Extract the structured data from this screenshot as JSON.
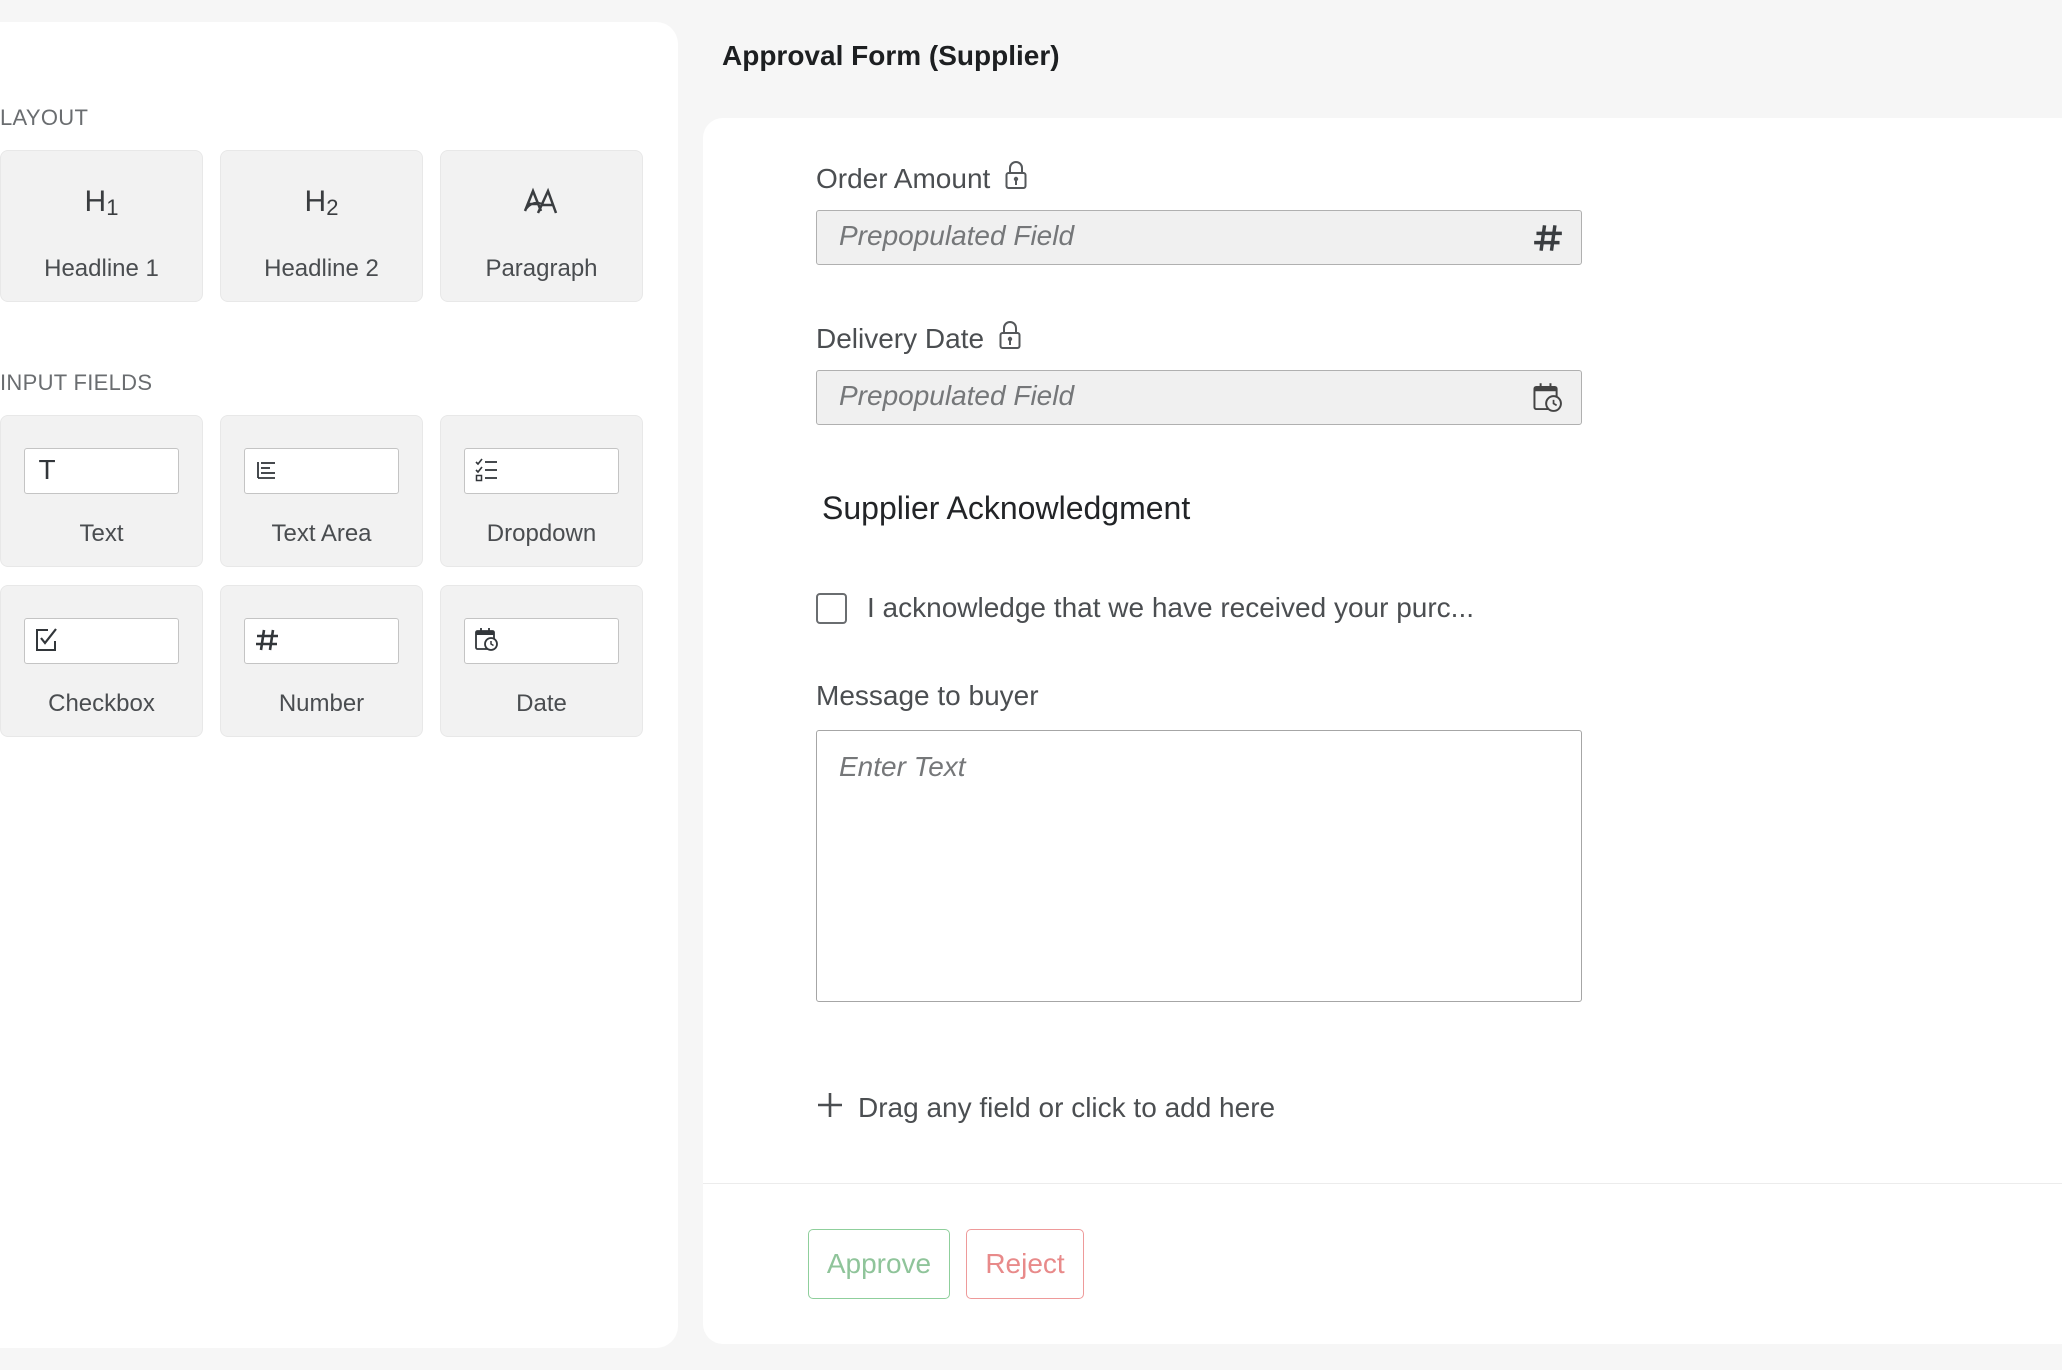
{
  "header": {
    "title": "Approval Form (Supplier)"
  },
  "palette": {
    "layout_label": "LAYOUT",
    "input_fields_label": "INPUT FIELDS",
    "layout_items": [
      {
        "label": "Headline 1",
        "icon": "headline-1-icon",
        "glyph": "H",
        "sub": "1"
      },
      {
        "label": "Headline 2",
        "icon": "headline-2-icon",
        "glyph": "H",
        "sub": "2"
      },
      {
        "label": "Paragraph",
        "icon": "paragraph-icon"
      }
    ],
    "input_items": [
      {
        "label": "Text",
        "icon": "text-icon"
      },
      {
        "label": "Text Area",
        "icon": "text-area-icon"
      },
      {
        "label": "Dropdown",
        "icon": "dropdown-icon"
      },
      {
        "label": "Checkbox",
        "icon": "checkbox-icon"
      },
      {
        "label": "Number",
        "icon": "number-icon"
      },
      {
        "label": "Date",
        "icon": "date-icon"
      }
    ]
  },
  "form": {
    "order_amount": {
      "label": "Order Amount",
      "placeholder": "Prepopulated Field",
      "locked": true,
      "suffix_icon": "number-icon"
    },
    "delivery_date": {
      "label": "Delivery Date",
      "placeholder": "Prepopulated Field",
      "locked": true,
      "suffix_icon": "calendar-icon"
    },
    "section_heading": "Supplier Acknowledgment",
    "acknowledge": {
      "text": "I acknowledge that we have received your purc...",
      "checked": false
    },
    "message": {
      "label": "Message to buyer",
      "placeholder": "Enter Text"
    },
    "add_field_text": "Drag any field or click to add here",
    "approve_label": "Approve",
    "reject_label": "Reject"
  },
  "colors": {
    "approve": "#8fc49a",
    "reject": "#e88a8a",
    "background": "#f6f6f6"
  }
}
